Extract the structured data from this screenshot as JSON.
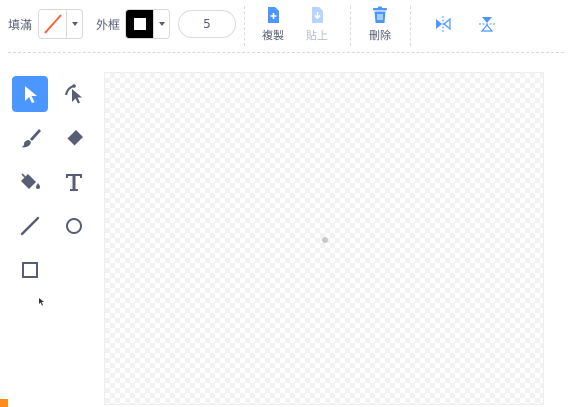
{
  "toolbar": {
    "fill_label": "填滿",
    "outline_label": "外框",
    "stroke_width": "5",
    "copy_label": "複製",
    "paste_label": "貼上",
    "delete_label": "刪除"
  },
  "colors": {
    "accent": "#4c97ff",
    "tool_icon": "#575e75",
    "fill_none_slash": "#ff5f3a",
    "outline_color": "#000000",
    "flip_icon": "#4c97ff",
    "disabled": "#b6bccc",
    "orange_mark": "#ff8c1a"
  },
  "tools": [
    {
      "name": "select",
      "icon": "arrow-pointer-icon",
      "active": true
    },
    {
      "name": "reshape",
      "icon": "reshape-pointer-icon",
      "active": false
    },
    {
      "name": "brush",
      "icon": "brush-icon",
      "active": false
    },
    {
      "name": "eraser",
      "icon": "eraser-icon",
      "active": false
    },
    {
      "name": "fill",
      "icon": "paint-bucket-icon",
      "active": false
    },
    {
      "name": "text",
      "icon": "text-t-icon",
      "active": false
    },
    {
      "name": "line",
      "icon": "line-icon",
      "active": false
    },
    {
      "name": "circle",
      "icon": "circle-icon",
      "active": false
    },
    {
      "name": "rectangle",
      "icon": "rectangle-icon",
      "active": false
    }
  ],
  "actions": [
    {
      "name": "copy",
      "icon": "copy-icon"
    },
    {
      "name": "paste",
      "icon": "paste-icon",
      "disabled": true
    },
    {
      "name": "delete",
      "icon": "trash-icon"
    },
    {
      "name": "flip-horizontal",
      "icon": "flip-horizontal-icon"
    },
    {
      "name": "flip-vertical",
      "icon": "flip-vertical-icon"
    }
  ]
}
